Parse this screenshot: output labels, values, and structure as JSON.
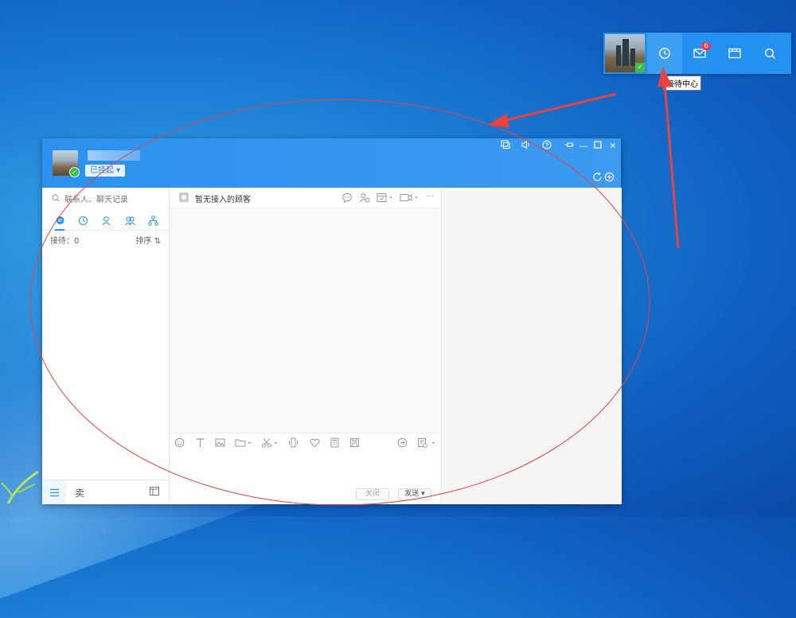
{
  "minibar": {
    "tooltip": "接待中心",
    "mail_badge": "6",
    "icons": [
      "clock-icon",
      "mail-icon",
      "window-icon",
      "search-icon"
    ]
  },
  "window": {
    "status_label": "已挂起 ▾",
    "search_placeholder": "联系人、聊天记录",
    "receiving_label": "接待：0",
    "sort_label": "排序 ⇅",
    "no_customer": "暂无接入的顾客",
    "sell_label": "卖",
    "close_button": "关闭",
    "send_button": "发送 ▾"
  },
  "colors": {
    "header_blue": "#2c92ee",
    "annotation_red": "#e8433f",
    "online_green": "#3cbf47"
  }
}
